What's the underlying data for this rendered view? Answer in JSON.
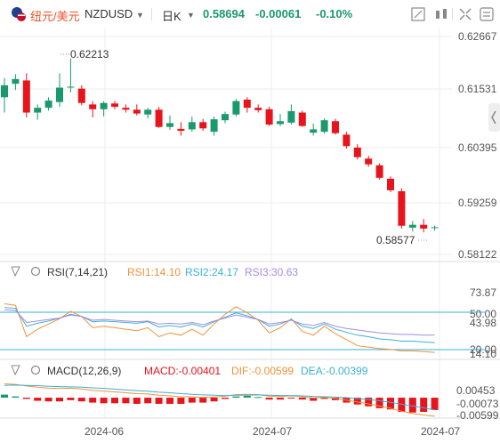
{
  "header": {
    "pair_label": "纽元/美元",
    "symbol": "NZDUSD",
    "period": "日K",
    "last_price": "0.58694",
    "change": "-0.00061",
    "change_pct": "-0.10%"
  },
  "colors": {
    "up": "#1a9a6c",
    "down": "#e8141b",
    "rsi1": "#f0923a",
    "rsi2": "#3bb0d6",
    "rsi3": "#a98be0",
    "macd_dif": "#f0923a",
    "macd_dea": "#3bb0d6"
  },
  "main_axis": {
    "ticks": [
      "0.62667",
      "0.61531",
      "0.60395",
      "0.59259",
      "0.58122"
    ],
    "ylim": [
      0.58122,
      0.62667
    ]
  },
  "annotations": {
    "high": "0.62213",
    "low": "0.58577"
  },
  "rsi": {
    "title": "RSI(7,14,21)",
    "rsi1_label": "RSI1:14.10",
    "rsi2_label": "RSI2:24.17",
    "rsi3_label": "RSI3:30.63",
    "ticks": [
      "73.87",
      "50.00",
      "43.98",
      "20.00",
      "14.10"
    ]
  },
  "macd": {
    "title": "MACD(12,26,9)",
    "macd_label": "MACD:-0.00401",
    "dif_label": "DIF:-0.00599",
    "dea_label": "DEA:-0.00399",
    "ticks": [
      "0.00453",
      "-0.00073",
      "-0.00599"
    ]
  },
  "x_labels": [
    "2024-06",
    "2024-07",
    "2024-07"
  ],
  "chart_data": {
    "type": "candlestick",
    "candles": [
      {
        "o": 0.614,
        "h": 0.618,
        "l": 0.6108,
        "c": 0.6165
      },
      {
        "o": 0.6168,
        "h": 0.6188,
        "l": 0.6155,
        "c": 0.6178
      },
      {
        "o": 0.6175,
        "h": 0.619,
        "l": 0.6098,
        "c": 0.6108
      },
      {
        "o": 0.6108,
        "h": 0.6125,
        "l": 0.6093,
        "c": 0.6118
      },
      {
        "o": 0.6118,
        "h": 0.614,
        "l": 0.6112,
        "c": 0.6133
      },
      {
        "o": 0.613,
        "h": 0.619,
        "l": 0.612,
        "c": 0.616
      },
      {
        "o": 0.616,
        "h": 0.6221,
        "l": 0.615,
        "c": 0.6162
      },
      {
        "o": 0.6158,
        "h": 0.6165,
        "l": 0.6123,
        "c": 0.6128
      },
      {
        "o": 0.6125,
        "h": 0.6132,
        "l": 0.6098,
        "c": 0.6115
      },
      {
        "o": 0.6115,
        "h": 0.6132,
        "l": 0.61,
        "c": 0.6128
      },
      {
        "o": 0.6127,
        "h": 0.6132,
        "l": 0.6115,
        "c": 0.612
      },
      {
        "o": 0.6118,
        "h": 0.6125,
        "l": 0.6108,
        "c": 0.6114
      },
      {
        "o": 0.6114,
        "h": 0.6125,
        "l": 0.6102,
        "c": 0.6106
      },
      {
        "o": 0.6104,
        "h": 0.6118,
        "l": 0.6096,
        "c": 0.6114
      },
      {
        "o": 0.6114,
        "h": 0.612,
        "l": 0.6076,
        "c": 0.6078
      },
      {
        "o": 0.6078,
        "h": 0.6102,
        "l": 0.6072,
        "c": 0.6086
      },
      {
        "o": 0.6074,
        "h": 0.6088,
        "l": 0.606,
        "c": 0.607
      },
      {
        "o": 0.6073,
        "h": 0.61,
        "l": 0.6068,
        "c": 0.6088
      },
      {
        "o": 0.6088,
        "h": 0.6095,
        "l": 0.607,
        "c": 0.6075
      },
      {
        "o": 0.6068,
        "h": 0.61,
        "l": 0.606,
        "c": 0.6094
      },
      {
        "o": 0.6092,
        "h": 0.611,
        "l": 0.6086,
        "c": 0.6105
      },
      {
        "o": 0.6104,
        "h": 0.6136,
        "l": 0.61,
        "c": 0.6132
      },
      {
        "o": 0.6135,
        "h": 0.614,
        "l": 0.6108,
        "c": 0.6118
      },
      {
        "o": 0.6118,
        "h": 0.6125,
        "l": 0.6108,
        "c": 0.6113
      },
      {
        "o": 0.6115,
        "h": 0.612,
        "l": 0.608,
        "c": 0.6083
      },
      {
        "o": 0.6084,
        "h": 0.6105,
        "l": 0.608,
        "c": 0.609
      },
      {
        "o": 0.6087,
        "h": 0.6125,
        "l": 0.6083,
        "c": 0.6111
      },
      {
        "o": 0.6108,
        "h": 0.6112,
        "l": 0.6078,
        "c": 0.608
      },
      {
        "o": 0.6066,
        "h": 0.6085,
        "l": 0.606,
        "c": 0.6073
      },
      {
        "o": 0.6068,
        "h": 0.6096,
        "l": 0.6064,
        "c": 0.6092
      },
      {
        "o": 0.609,
        "h": 0.6095,
        "l": 0.6062,
        "c": 0.6065
      },
      {
        "o": 0.6062,
        "h": 0.6068,
        "l": 0.6033,
        "c": 0.6038
      },
      {
        "o": 0.6035,
        "h": 0.6042,
        "l": 0.601,
        "c": 0.6015
      },
      {
        "o": 0.6012,
        "h": 0.6018,
        "l": 0.5995,
        "c": 0.6
      },
      {
        "o": 0.5998,
        "h": 0.6002,
        "l": 0.5968,
        "c": 0.5972
      },
      {
        "o": 0.597,
        "h": 0.5975,
        "l": 0.5942,
        "c": 0.5946
      },
      {
        "o": 0.5944,
        "h": 0.595,
        "l": 0.5866,
        "c": 0.5872
      },
      {
        "o": 0.5868,
        "h": 0.5882,
        "l": 0.586,
        "c": 0.5874
      },
      {
        "o": 0.5874,
        "h": 0.5886,
        "l": 0.5858,
        "c": 0.5866
      },
      {
        "o": 0.5868,
        "h": 0.5872,
        "l": 0.5862,
        "c": 0.5869
      }
    ],
    "rsi1": [
      72,
      70,
      28,
      38,
      45,
      52,
      62,
      55,
      40,
      42,
      40,
      38,
      36,
      40,
      28,
      33,
      30,
      38,
      30,
      45,
      58,
      68,
      60,
      50,
      33,
      40,
      52,
      35,
      30,
      42,
      32,
      24,
      16,
      14,
      12,
      11,
      9,
      9,
      8,
      7
    ],
    "rsi2": [
      67,
      66,
      42,
      46,
      49,
      53,
      58,
      55,
      48,
      49,
      48,
      47,
      46,
      48,
      41,
      43,
      41,
      45,
      41,
      48,
      54,
      60,
      56,
      51,
      42,
      45,
      51,
      42,
      39,
      45,
      38,
      34,
      30,
      28,
      25,
      24,
      22,
      22,
      21,
      20
    ],
    "rsi3": [
      64,
      63,
      47,
      49,
      51,
      53,
      57,
      55,
      50,
      51,
      50,
      49,
      48,
      49,
      45,
      46,
      45,
      47,
      44,
      49,
      53,
      57,
      54,
      51,
      45,
      47,
      50,
      45,
      43,
      47,
      42,
      39,
      37,
      35,
      33,
      32,
      31,
      31,
      30,
      30
    ],
    "macd_dif": [
      0.0045,
      0.0043,
      0.0038,
      0.0034,
      0.0031,
      0.003,
      0.0031,
      0.0028,
      0.0024,
      0.0021,
      0.0019,
      0.0016,
      0.0013,
      0.0012,
      0.0008,
      0.0006,
      0.0003,
      0.0003,
      0.0001,
      0.0002,
      0.0005,
      0.001,
      0.0011,
      0.001,
      0.0005,
      0.0004,
      0.0006,
      0.0003,
      -0.0001,
      0.0001,
      -0.0002,
      -0.0008,
      -0.0014,
      -0.002,
      -0.0027,
      -0.0034,
      -0.0044,
      -0.0051,
      -0.0056,
      -0.006
    ],
    "macd_dea": [
      0.004,
      0.0041,
      0.004,
      0.0039,
      0.0037,
      0.0036,
      0.0035,
      0.0034,
      0.0032,
      0.003,
      0.0028,
      0.0025,
      0.0023,
      0.0021,
      0.0018,
      0.0016,
      0.0013,
      0.0011,
      0.0009,
      0.0008,
      0.0007,
      0.0008,
      0.0008,
      0.0009,
      0.0008,
      0.0007,
      0.0007,
      0.0006,
      0.0004,
      0.0003,
      0.0002,
      0.0,
      -0.0003,
      -0.0006,
      -0.001,
      -0.0015,
      -0.0021,
      -0.0027,
      -0.0033,
      -0.004
    ],
    "ylim_rsi": [
      0,
      100
    ],
    "ylim_macd": [
      -0.0072,
      0.0055
    ]
  }
}
